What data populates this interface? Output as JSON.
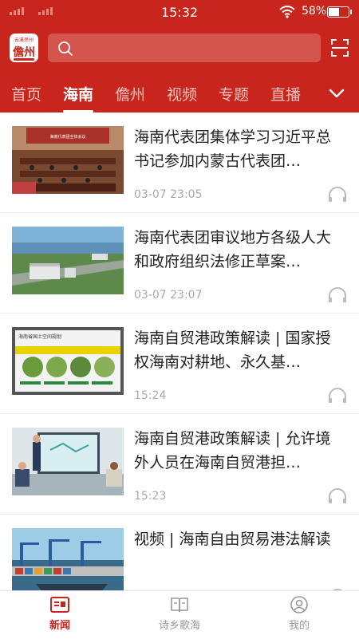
{
  "status_bar": {
    "time": "15:32",
    "battery": "58%",
    "battery_level": 0.58
  },
  "header": {
    "logo": {
      "line1": "云溪思州",
      "line2": "儋州"
    },
    "search": {
      "placeholder": ""
    }
  },
  "tabs": [
    {
      "label": "首页",
      "active": false
    },
    {
      "label": "海南",
      "active": true
    },
    {
      "label": "儋州",
      "active": false
    },
    {
      "label": "视频",
      "active": false
    },
    {
      "label": "专题",
      "active": false
    },
    {
      "label": "直播",
      "active": false
    }
  ],
  "articles": [
    {
      "title": "海南代表团集体学习习近平总书记参加内蒙古代表团…",
      "time": "03-07 23:05",
      "thumb": "meeting",
      "thumb_text": "海南代表团全体会议"
    },
    {
      "title": "海南代表团审议地方各级人大和政府组织法修正草案…",
      "time": "03-07 23:07",
      "thumb": "aerial",
      "thumb_text": ""
    },
    {
      "title": "海南自贸港政策解读 | 国家授权海南对耕地、永久基…",
      "time": "15:24",
      "thumb": "land",
      "thumb_text": "海南省国土空间规划"
    },
    {
      "title": "海南自贸港政策解读 | 允许境外人员在海南自贸港担…",
      "time": "15:23",
      "thumb": "presenter",
      "thumb_text": ""
    },
    {
      "title": "视频 | 海南自由贸易港法解读",
      "time": "",
      "thumb": "port",
      "thumb_text": ""
    }
  ],
  "bottom_nav": [
    {
      "label": "新闻",
      "icon": "news-icon",
      "active": true
    },
    {
      "label": "诗乡歌海",
      "icon": "book-icon",
      "active": false
    },
    {
      "label": "我的",
      "icon": "user-icon",
      "active": false
    }
  ],
  "colors": {
    "brand": "#c8261c",
    "text": "#222222",
    "muted": "#aaaaaa"
  }
}
